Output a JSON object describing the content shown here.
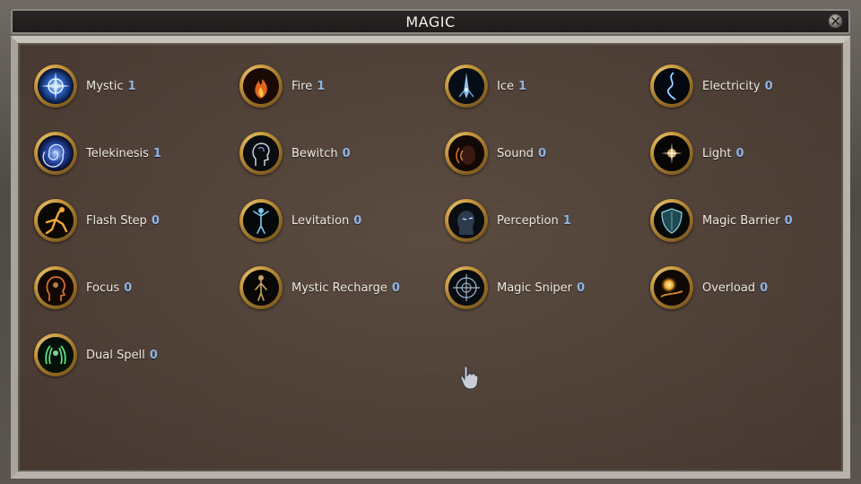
{
  "window": {
    "title": "MAGIC"
  },
  "skills": [
    {
      "name": "Mystic",
      "level": "1",
      "icon": "mystic-icon"
    },
    {
      "name": "Fire",
      "level": "1",
      "icon": "fire-icon"
    },
    {
      "name": "Ice",
      "level": "1",
      "icon": "ice-icon"
    },
    {
      "name": "Electricity",
      "level": "0",
      "icon": "electricity-icon"
    },
    {
      "name": "Telekinesis",
      "level": "1",
      "icon": "telekinesis-icon"
    },
    {
      "name": "Bewitch",
      "level": "0",
      "icon": "bewitch-icon"
    },
    {
      "name": "Sound",
      "level": "0",
      "icon": "sound-icon"
    },
    {
      "name": "Light",
      "level": "0",
      "icon": "light-icon"
    },
    {
      "name": "Flash Step",
      "level": "0",
      "icon": "flash-step-icon"
    },
    {
      "name": "Levitation",
      "level": "0",
      "icon": "levitation-icon"
    },
    {
      "name": "Perception",
      "level": "1",
      "icon": "perception-icon"
    },
    {
      "name": "Magic Barrier",
      "level": "0",
      "icon": "magic-barrier-icon"
    },
    {
      "name": "Focus",
      "level": "0",
      "icon": "focus-icon"
    },
    {
      "name": "Mystic Recharge",
      "level": "0",
      "icon": "mystic-recharge-icon"
    },
    {
      "name": "Magic Sniper",
      "level": "0",
      "icon": "magic-sniper-icon"
    },
    {
      "name": "Overload",
      "level": "0",
      "icon": "overload-icon"
    },
    {
      "name": "Dual Spell",
      "level": "0",
      "icon": "dual-spell-icon"
    }
  ],
  "colors": {
    "level_text": "#8fb3e6",
    "label_text": "#eeeae3",
    "icon_ring": "#c99a3e"
  }
}
